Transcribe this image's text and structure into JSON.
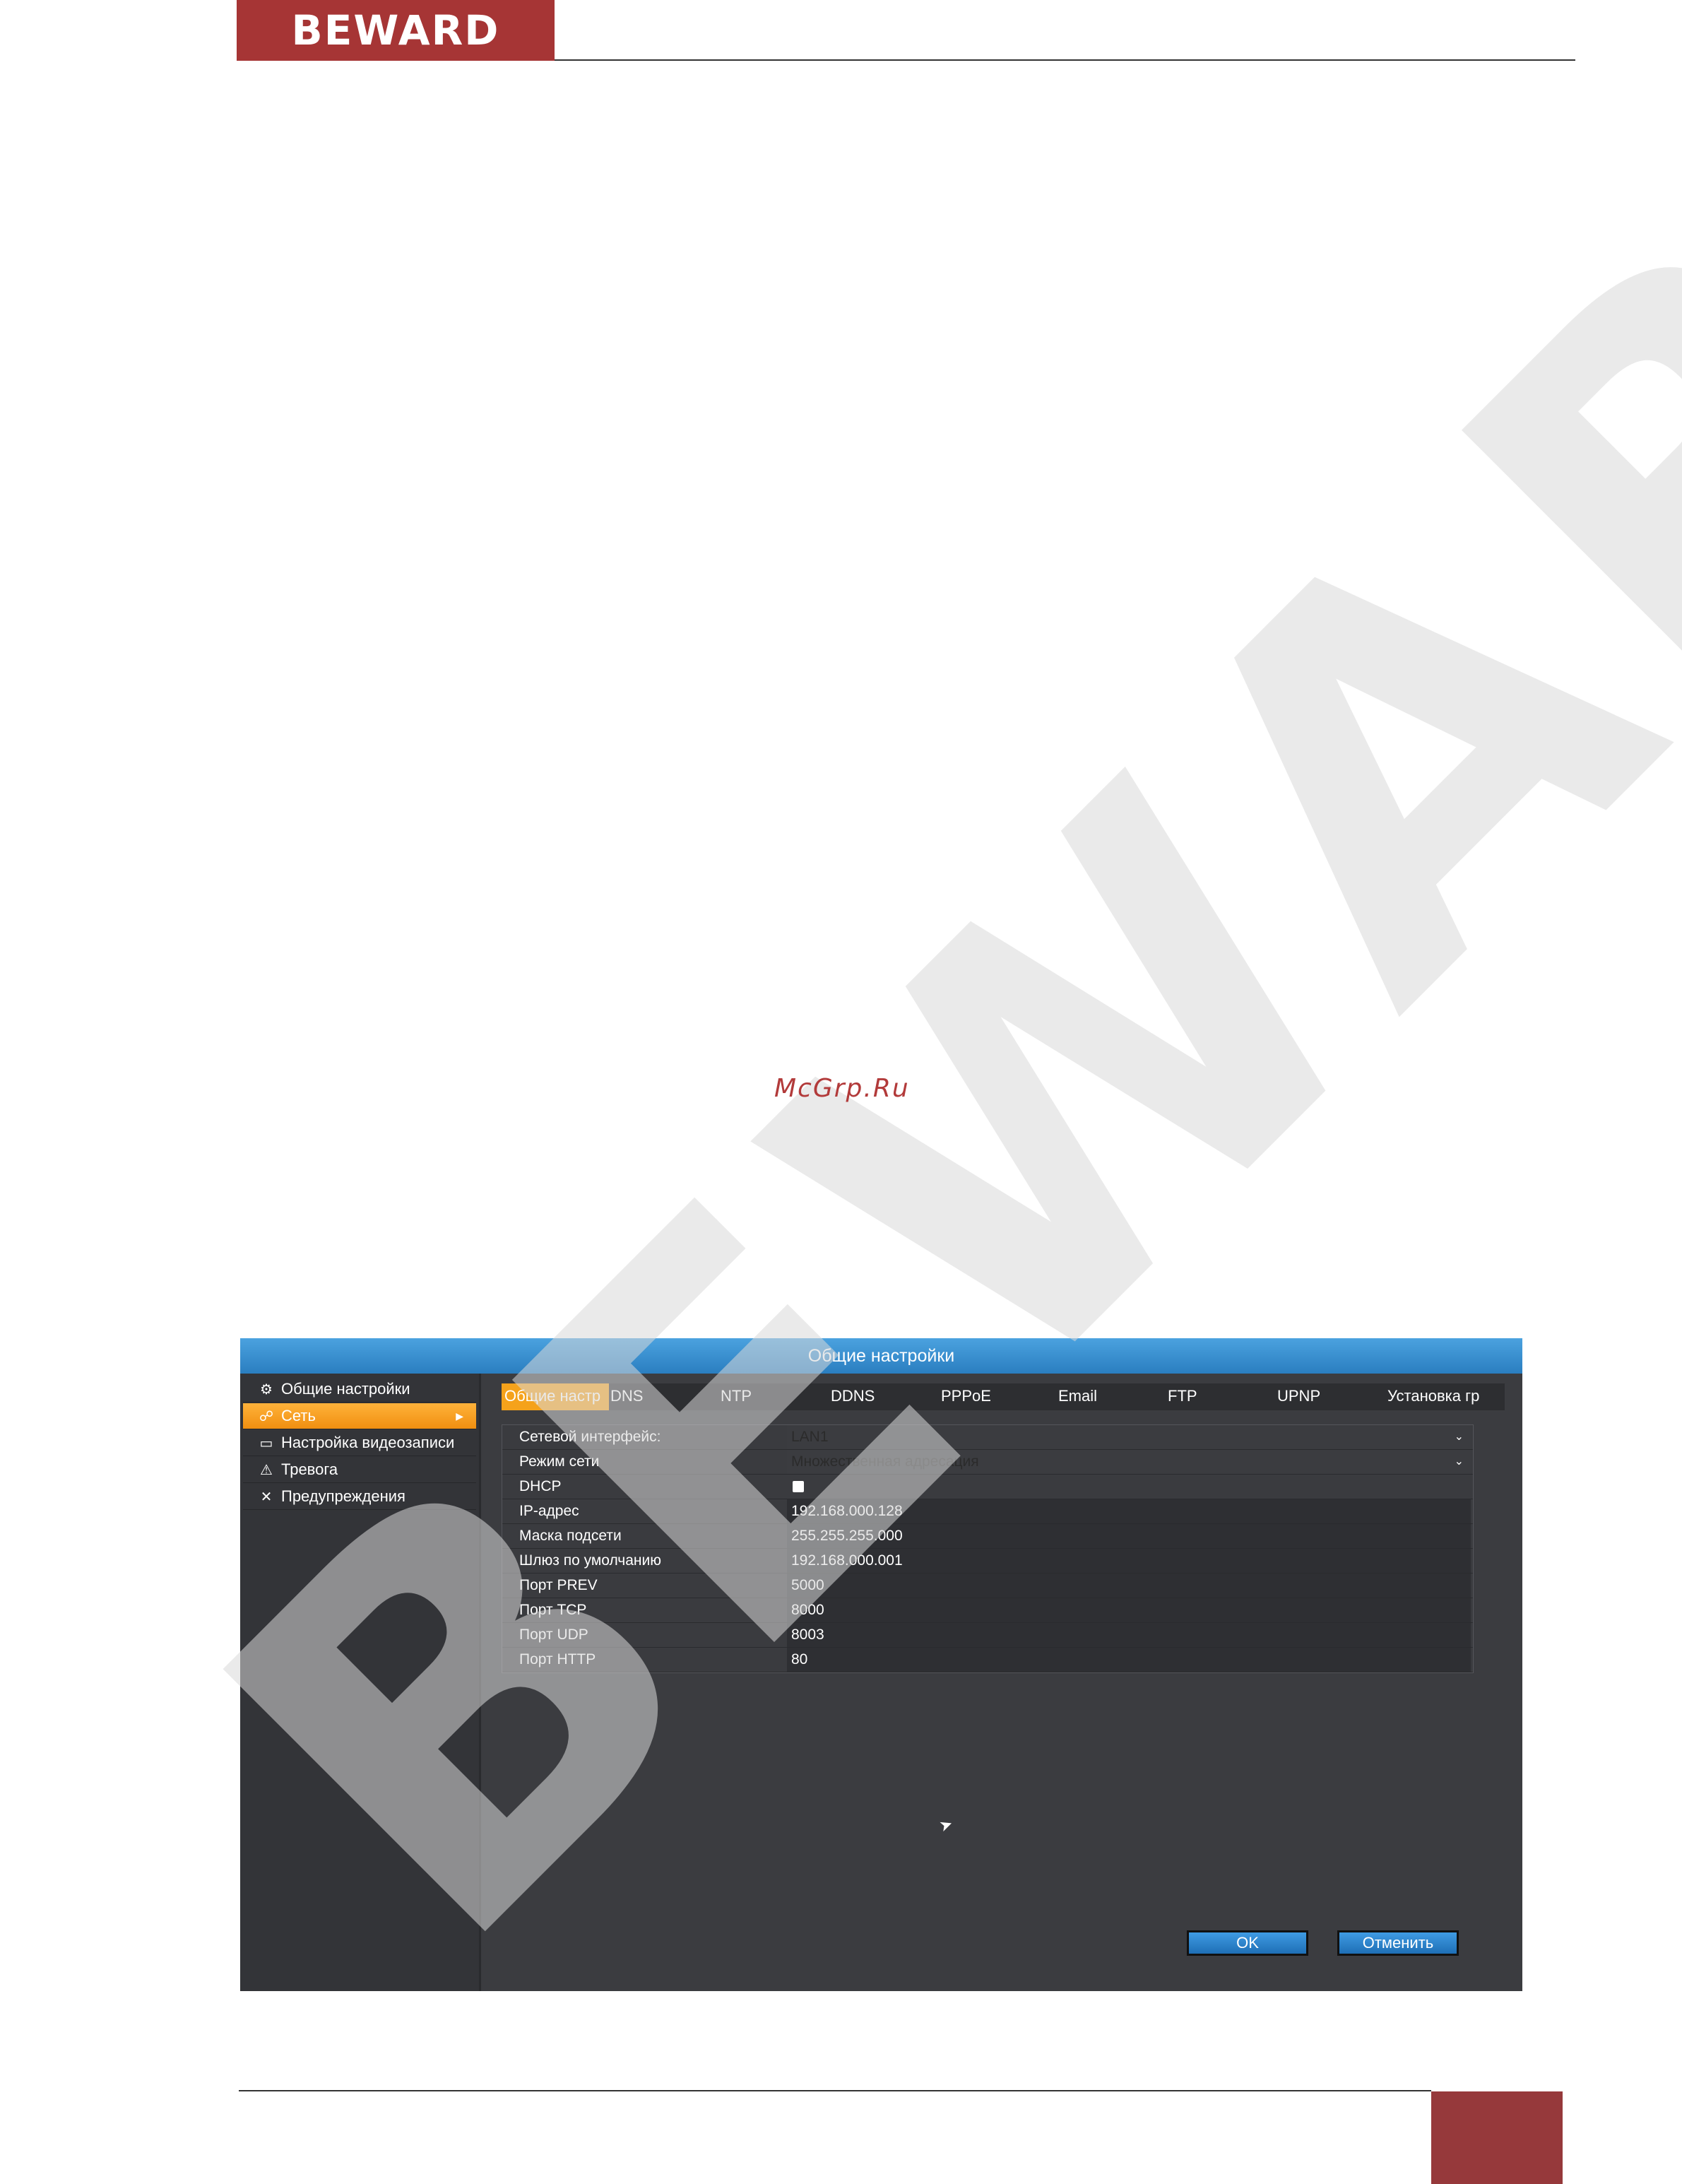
{
  "header": {
    "logo": "BEWARD"
  },
  "watermark": {
    "text": "BEWARD"
  },
  "site_link": "McGrp.Ru",
  "window": {
    "title": "Общие настройки",
    "sidebar": {
      "items": [
        {
          "label": "Общие настройки",
          "icon": "gears-icon",
          "active": false
        },
        {
          "label": "Сеть",
          "icon": "network-icon",
          "active": true
        },
        {
          "label": "Настройка видеозаписи",
          "icon": "film-icon",
          "active": false
        },
        {
          "label": "Тревога",
          "icon": "warning-icon",
          "active": false
        },
        {
          "label": "Предупреждения",
          "icon": "tools-icon",
          "active": false
        }
      ]
    },
    "tabs": [
      "Общие настр",
      "DNS",
      "NTP",
      "DDNS",
      "PPPoE",
      "Email",
      "FTP",
      "UPNP",
      "Установка гр"
    ],
    "active_tab": "Общие настр",
    "form": {
      "rows": [
        {
          "label": "Сетевой интерфейс:",
          "value": "LAN1",
          "type": "select"
        },
        {
          "label": "Режим сети",
          "value": "Множественная адресация",
          "type": "select"
        },
        {
          "label": "DHCP",
          "value": "",
          "type": "checkbox",
          "checked": false
        },
        {
          "label": "IP-адрес",
          "value": "192.168.000.128",
          "type": "text"
        },
        {
          "label": "Маска подсети",
          "value": "255.255.255.000",
          "type": "text"
        },
        {
          "label": "Шлюз по умолчанию",
          "value": "192.168.000.001",
          "type": "text"
        },
        {
          "label": "Порт PREV",
          "value": "5000",
          "type": "text"
        },
        {
          "label": "Порт TCP",
          "value": "8000",
          "type": "text"
        },
        {
          "label": "Порт UDP",
          "value": "8003",
          "type": "text"
        },
        {
          "label": "Порт HTTP",
          "value": "80",
          "type": "text"
        }
      ]
    },
    "buttons": {
      "ok": "OK",
      "cancel": "Отменить"
    }
  },
  "colors": {
    "brand": "#a63535",
    "title_bar": "#2a7ec0",
    "active_accent": "#f5a21b",
    "panel_bg": "#3b3c40"
  }
}
